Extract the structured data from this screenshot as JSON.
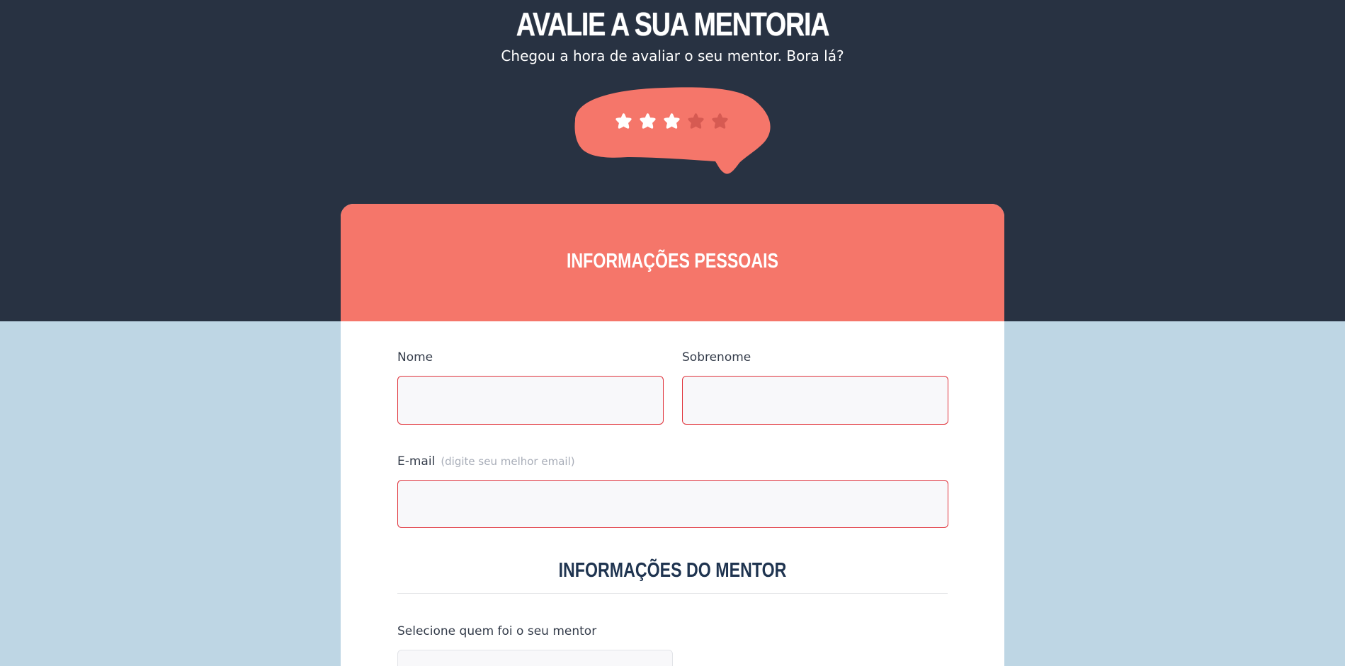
{
  "header": {
    "title": "AVALIE A SUA MENTORIA",
    "subtitle": "Chegou a hora de avaliar o seu mentor. Bora lá?"
  },
  "rating": {
    "value": 3,
    "max": 5,
    "filled_color": "#ffffff",
    "empty_color": "#d65a52",
    "bubble_color": "#f5766a"
  },
  "personal_info": {
    "title": "INFORMAÇÕES PESSOAIS",
    "first_name": {
      "label": "Nome",
      "value": ""
    },
    "last_name": {
      "label": "Sobrenome",
      "value": ""
    },
    "email": {
      "label": "E-mail",
      "hint": "(digite seu melhor email)",
      "value": ""
    }
  },
  "mentor_info": {
    "title": "INFORMAÇÕES DO MENTOR",
    "select": {
      "label": "Selecione quem foi o seu mentor",
      "value": ""
    }
  },
  "colors": {
    "dark_band": "#283242",
    "page_background": "#bed6e4",
    "accent": "#f5766a",
    "error_border": "#e0323a",
    "section_title": "#1f3450"
  }
}
